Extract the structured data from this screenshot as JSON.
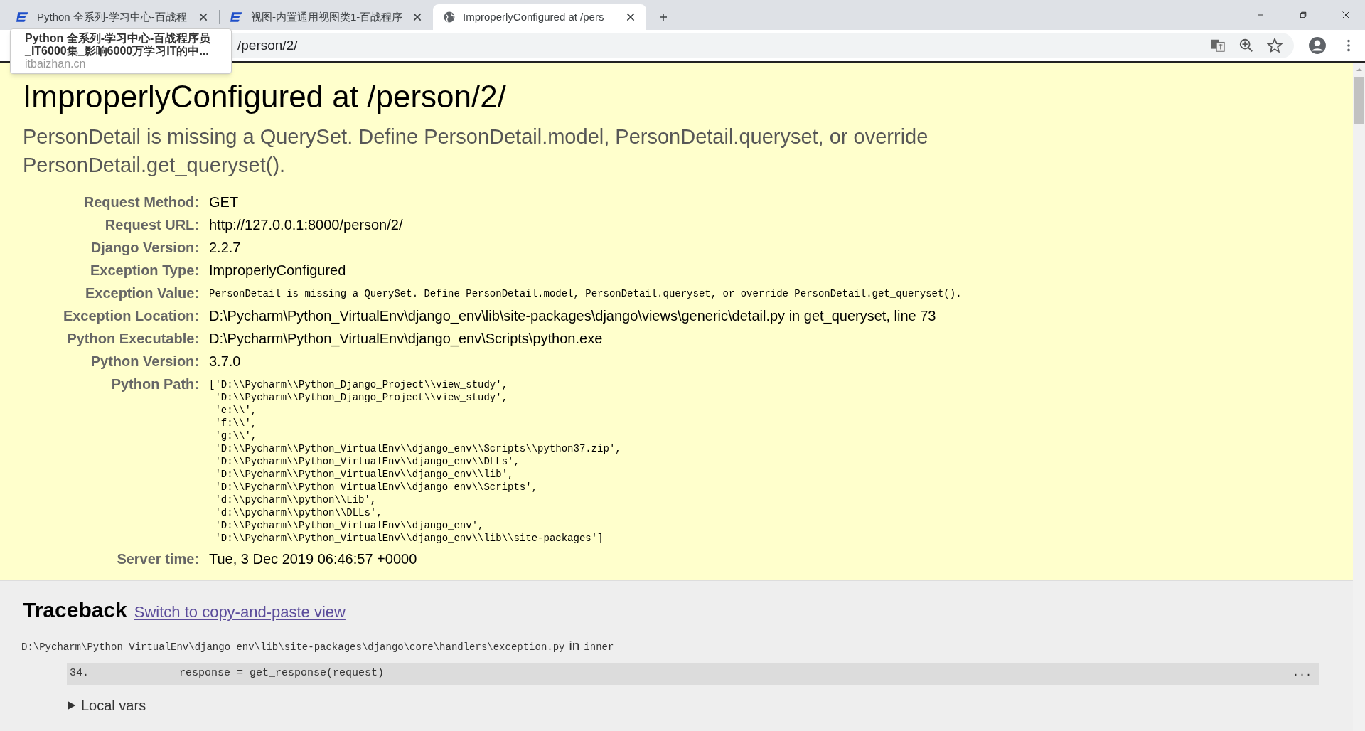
{
  "browser": {
    "tabs": [
      {
        "title": "Python 全系列-学习中心-百战程",
        "selected": false
      },
      {
        "title": "视图-内置通用视图类1-百战程序",
        "selected": false
      },
      {
        "title": "ImproperlyConfigured at /pers",
        "selected": true
      }
    ],
    "address": "/person/2/",
    "tooltip": {
      "title": "Python 全系列-学习中心-百战程序员",
      "subtitle": "_IT6000集_影响6000万学习IT的中...",
      "url": "itbaizhan.cn"
    }
  },
  "error": {
    "title": "ImproperlyConfigured at /person/2/",
    "summary": "PersonDetail is missing a QuerySet. Define PersonDetail.model, PersonDetail.queryset, or override PersonDetail.get_queryset().",
    "meta": [
      {
        "label": "Request Method:",
        "value": "GET",
        "kind": "text"
      },
      {
        "label": "Request URL:",
        "value": "http://127.0.0.1:8000/person/2/",
        "kind": "text"
      },
      {
        "label": "Django Version:",
        "value": "2.2.7",
        "kind": "text"
      },
      {
        "label": "Exception Type:",
        "value": "ImproperlyConfigured",
        "kind": "text"
      },
      {
        "label": "Exception Value:",
        "value": "PersonDetail is missing a QuerySet. Define PersonDetail.model, PersonDetail.queryset, or override PersonDetail.get_queryset().",
        "kind": "code"
      },
      {
        "label": "Exception Location:",
        "value": "D:\\Pycharm\\Python_VirtualEnv\\django_env\\lib\\site-packages\\django\\views\\generic\\detail.py in get_queryset, line 73",
        "kind": "text"
      },
      {
        "label": "Python Executable:",
        "value": "D:\\Pycharm\\Python_VirtualEnv\\django_env\\Scripts\\python.exe",
        "kind": "text"
      },
      {
        "label": "Python Version:",
        "value": "3.7.0",
        "kind": "text"
      },
      {
        "label": "Python Path:",
        "value": "['D:\\\\Pycharm\\\\Python_Django_Project\\\\view_study',\n 'D:\\\\Pycharm\\\\Python_Django_Project\\\\view_study',\n 'e:\\\\',\n 'f:\\\\',\n 'g:\\\\',\n 'D:\\\\Pycharm\\\\Python_VirtualEnv\\\\django_env\\\\Scripts\\\\python37.zip',\n 'D:\\\\Pycharm\\\\Python_VirtualEnv\\\\django_env\\\\DLLs',\n 'D:\\\\Pycharm\\\\Python_VirtualEnv\\\\django_env\\\\lib',\n 'D:\\\\Pycharm\\\\Python_VirtualEnv\\\\django_env\\\\Scripts',\n 'd:\\\\pycharm\\\\python\\\\Lib',\n 'd:\\\\pycharm\\\\python\\\\DLLs',\n 'D:\\\\Pycharm\\\\Python_VirtualEnv\\\\django_env',\n 'D:\\\\Pycharm\\\\Python_VirtualEnv\\\\django_env\\\\lib\\\\site-packages']",
        "kind": "code"
      },
      {
        "label": "Server time:",
        "value": "Tue, 3 Dec 2019 06:46:57 +0000",
        "kind": "text"
      }
    ]
  },
  "traceback": {
    "heading": "Traceback",
    "switch_link": "Switch to copy-and-paste view",
    "frames": [
      {
        "file": "D:\\Pycharm\\Python_VirtualEnv\\django_env\\lib\\site-packages\\django\\core\\handlers\\exception.py",
        "in": "in",
        "function": "inner",
        "line_number": "34.",
        "code": "response = get_response(request)",
        "more": "...",
        "local_vars": "Local vars",
        "expanded": false
      }
    ]
  }
}
